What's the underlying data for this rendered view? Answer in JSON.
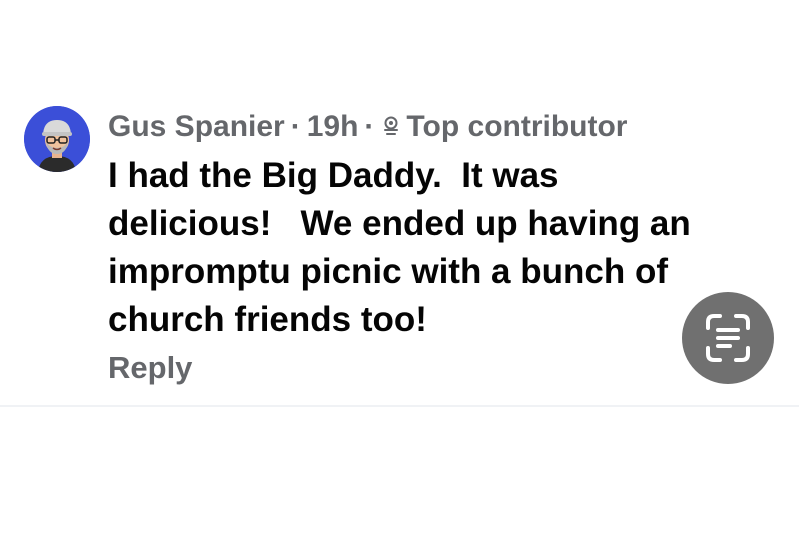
{
  "comment": {
    "author": "Gus Spanier",
    "separator": "·",
    "time": "19h",
    "badge_icon": "top-contributor-icon",
    "badge_label": "Top contributor",
    "text": "I had the Big Daddy.  It was\ndelicious!   We ended up having an\nimpromptu picnic with a bunch of\nchurch friends too!",
    "reply_label": "Reply"
  },
  "overlay": {
    "scan_icon": "text-scan-icon"
  },
  "colors": {
    "meta_gray": "#65676b",
    "text_black": "#050505",
    "avatar_bg": "#3b4fd8",
    "scan_button_bg": "#707070"
  }
}
